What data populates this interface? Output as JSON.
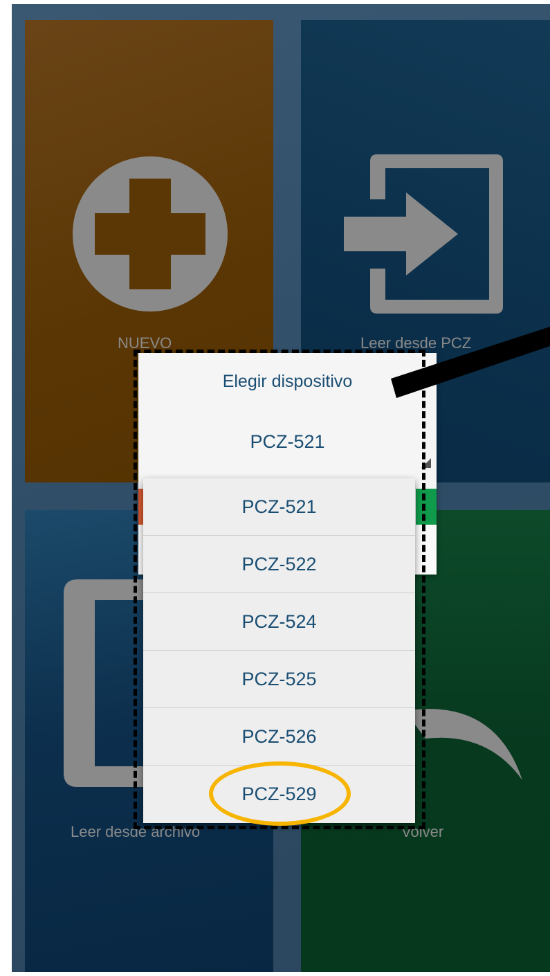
{
  "tiles": {
    "new": {
      "label": "NUEVO"
    },
    "read_pcz": {
      "label": "Leer desde PCZ"
    },
    "read_file": {
      "label": "Leer desde archivo"
    },
    "back": {
      "label": "Volver"
    }
  },
  "dialog": {
    "title": "Elegir dispositivo",
    "selected_device": "PCZ-521"
  },
  "dropdown": {
    "options": [
      "PCZ-521",
      "PCZ-522",
      "PCZ-524",
      "PCZ-525",
      "PCZ-526",
      "PCZ-529"
    ],
    "highlighted": "PCZ-529"
  },
  "colors": {
    "tile_new": "#5a3604",
    "tile_read_pcz": "#0b2f4a",
    "tile_read_file": "#0c2f4d",
    "tile_back": "#07391f",
    "dialog_text": "#1a4e73",
    "highlight_circle": "#f7b400"
  },
  "icons": {
    "new": "plus-circle-icon",
    "read_pcz": "sign-in-icon",
    "read_file": "file-icon",
    "back": "back-arrow-icon"
  }
}
